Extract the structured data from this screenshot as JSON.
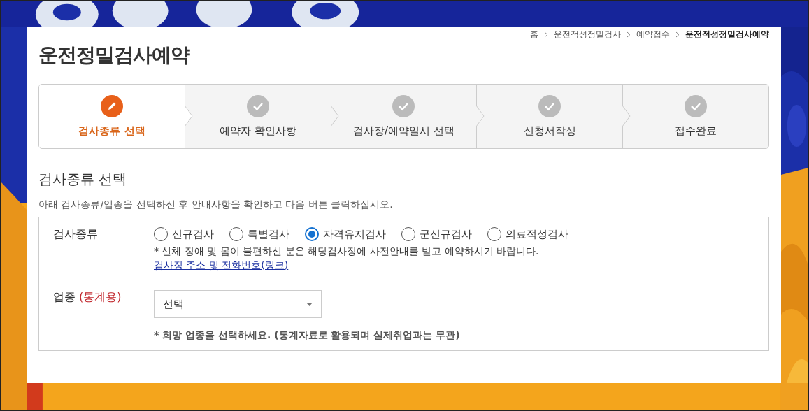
{
  "background": {
    "kind": "picture"
  },
  "breadcrumb": [
    "홈",
    "운전적성정밀검사",
    "예약접수",
    "운전적성정밀검사예약"
  ],
  "title": "운전정밀검사예약",
  "steps": [
    {
      "label": "검사종류 선택",
      "selected": true
    },
    {
      "label": "예약자 확인사항",
      "selected": false
    },
    {
      "label": "검사장/예약일시 선택",
      "selected": false
    },
    {
      "label": "신청서작성",
      "selected": false
    },
    {
      "label": "접수완료",
      "selected": false
    }
  ],
  "section": {
    "heading": "검사종류 선택",
    "description": "아래 검사종류/업종을 선택하신 후 안내사항을 확인하고 다음 버튼 클릭하십시오."
  },
  "form": {
    "exam_type": {
      "label": "검사종류",
      "options": [
        {
          "label": "신규검사",
          "selected": false
        },
        {
          "label": "특별검사",
          "selected": false
        },
        {
          "label": "자격유지검사",
          "selected": true
        },
        {
          "label": "군신규검사",
          "selected": false
        },
        {
          "label": "의료적성검사",
          "selected": false
        }
      ],
      "notice": "* 신체 장애 및 몸이 불편하신 분은 해당검사장에 사전안내를 받고 예약하시기 바랍니다.",
      "link": "검사장 주소 및 전화번호(링크)"
    },
    "industry": {
      "label": "업종",
      "label_note": "(통계용)",
      "select_value": "선택",
      "hint": "* 희망 업종을 선택하세요. (통계자료로 활용되며 실제취업과는 무관)"
    }
  }
}
